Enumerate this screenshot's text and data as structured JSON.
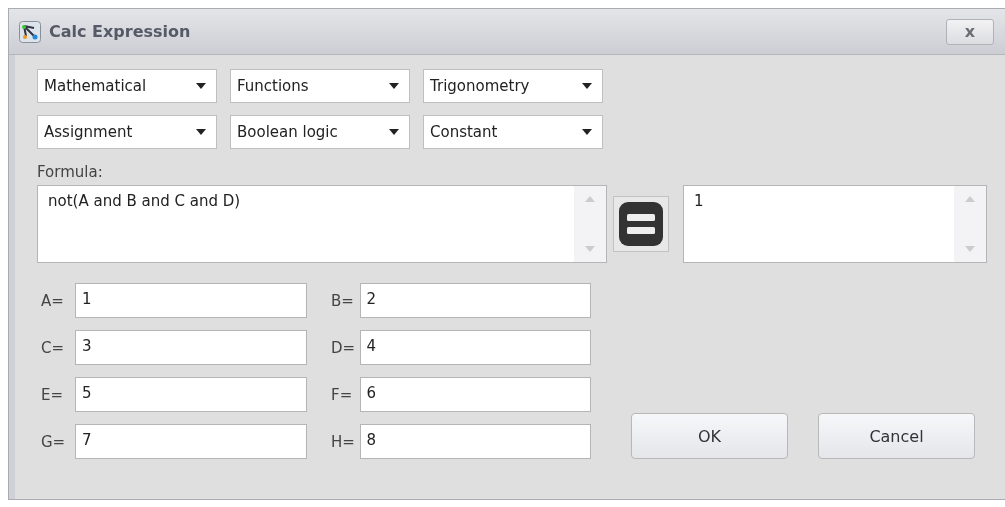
{
  "window": {
    "title": "Calc Expression",
    "close": "x"
  },
  "dropdowns": [
    {
      "value": "Mathematical"
    },
    {
      "value": "Functions"
    },
    {
      "value": "Trigonometry"
    },
    {
      "value": "Assignment"
    },
    {
      "value": "Boolean logic"
    },
    {
      "value": "Constant"
    }
  ],
  "formula": {
    "label": "Formula:",
    "value": "not(A and B and C and D)"
  },
  "result": {
    "value": "1"
  },
  "variables": [
    {
      "label": "A=",
      "value": "1"
    },
    {
      "label": "B=",
      "value": "2"
    },
    {
      "label": "C=",
      "value": "3"
    },
    {
      "label": "D=",
      "value": "4"
    },
    {
      "label": "E=",
      "value": "5"
    },
    {
      "label": "F=",
      "value": "6"
    },
    {
      "label": "G=",
      "value": "7"
    },
    {
      "label": "H=",
      "value": "8"
    }
  ],
  "buttons": [
    "OK",
    "Cancel"
  ]
}
